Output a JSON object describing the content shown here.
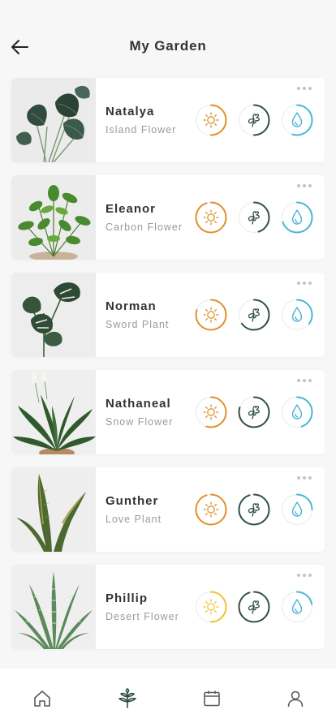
{
  "header": {
    "title": "My Garden",
    "back_icon": "arrow-left-icon"
  },
  "colors": {
    "sun": "#E0902A",
    "sun_light": "#F1C232",
    "plant": "#2F4F45",
    "water": "#4BB5D6",
    "track": "#EDEDED"
  },
  "plants": [
    {
      "name": "Natalya",
      "subtitle": "Island Flower",
      "photo": "anthurium-photo",
      "sun": 0.5,
      "plant": 0.5,
      "water": 0.55,
      "sun_variant": "sun"
    },
    {
      "name": "Eleanor",
      "subtitle": "Carbon Flower",
      "photo": "pothos-photo",
      "sun": 0.95,
      "plant": 0.45,
      "water": 0.7,
      "sun_variant": "sun"
    },
    {
      "name": "Norman",
      "subtitle": "Sword Plant",
      "photo": "monstera-photo",
      "sun": 0.8,
      "plant": 0.65,
      "water": 0.35,
      "sun_variant": "sun"
    },
    {
      "name": "Nathaneal",
      "subtitle": "Snow Flower",
      "photo": "peace-lily-photo",
      "sun": 0.55,
      "plant": 0.8,
      "water": 0.45,
      "sun_variant": "sun"
    },
    {
      "name": "Gunther",
      "subtitle": "Love Plant",
      "photo": "snake-plant-photo",
      "sun": 0.95,
      "plant": 0.95,
      "water": 0.25,
      "sun_variant": "sun"
    },
    {
      "name": "Phillip",
      "subtitle": "Desert Flower",
      "photo": "aloe-photo",
      "sun": 0.5,
      "plant": 0.95,
      "water": 0.22,
      "sun_variant": "sun_light"
    }
  ],
  "nav": {
    "items": [
      {
        "icon": "home-icon",
        "active": false
      },
      {
        "icon": "leaf-icon",
        "active": true
      },
      {
        "icon": "calendar-icon",
        "active": false
      },
      {
        "icon": "profile-icon",
        "active": false
      }
    ]
  }
}
